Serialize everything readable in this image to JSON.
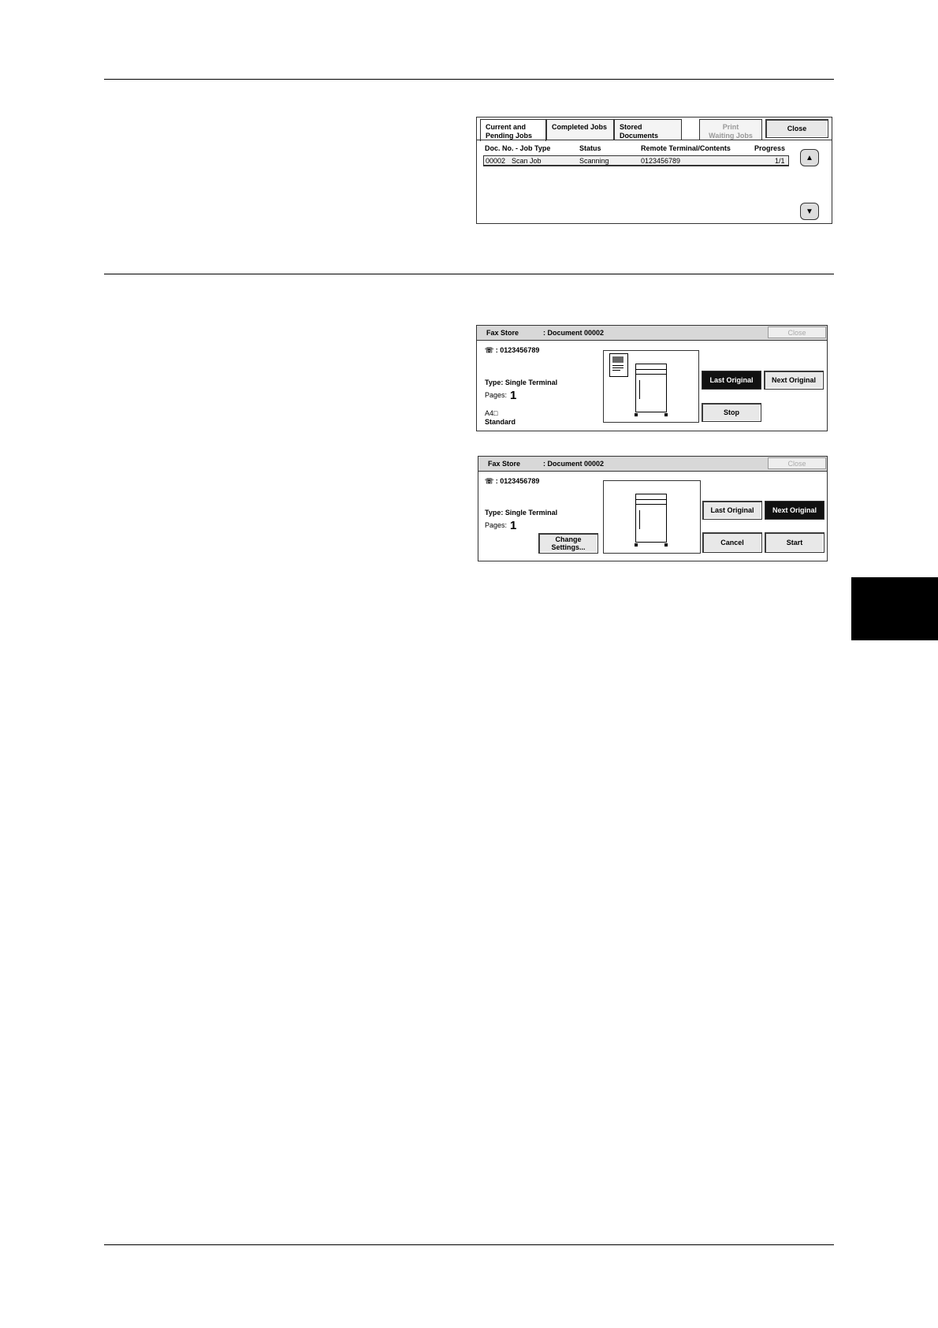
{
  "job_screen": {
    "tabs": [
      "Current and Pending Jobs",
      "Completed Jobs",
      "Stored Documents",
      "Print Waiting Jobs"
    ],
    "tab_lines": [
      [
        "Current and",
        "Pending Jobs"
      ],
      [
        "Completed Jobs"
      ],
      [
        "Stored",
        "Documents"
      ],
      [
        "Print",
        "Waiting Jobs"
      ]
    ],
    "close_label": "Close",
    "columns": {
      "doc": "Doc. No. - Job Type",
      "status": "Status",
      "remote": "Remote Terminal/Contents",
      "progress": "Progress"
    },
    "row": {
      "doc_no": "00002",
      "job_type": "Scan Job",
      "status": "Scanning",
      "remote": "0123456789",
      "progress": "1/1"
    },
    "scroll_up_icon": "triangle-up-icon",
    "scroll_down_icon": "triangle-down-icon"
  },
  "fax_screen_1": {
    "title": "Fax Store",
    "document": ": Document 00002",
    "close_label": "Close",
    "phone_icon": "telephone-icon",
    "phone": ": 0123456789",
    "type": "Type: Single Terminal",
    "pages_label": "Pages:",
    "pages_value": "1",
    "paper": "A4□",
    "resolution": "Standard",
    "last_original": "Last Original",
    "next_original": "Next Original",
    "stop": "Stop"
  },
  "fax_screen_2": {
    "title": "Fax Store",
    "document": ": Document 00002",
    "close_label": "Close",
    "phone_icon": "telephone-icon",
    "phone": ": 0123456789",
    "type": "Type: Single Terminal",
    "pages_label": "Pages:",
    "pages_value": "1",
    "change_settings_1": "Change",
    "change_settings_2": "Settings...",
    "last_original": "Last Original",
    "next_original": "Next Original",
    "cancel": "Cancel",
    "start": "Start"
  }
}
